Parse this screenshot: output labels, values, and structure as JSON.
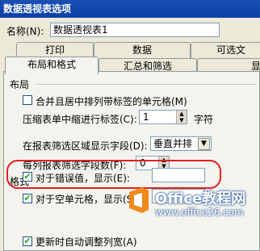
{
  "window": {
    "title": "数据透视表选项"
  },
  "name_field": {
    "label": "名称(N):",
    "value": "数据透视表1"
  },
  "tabs_back": [
    {
      "label": "打印"
    },
    {
      "label": "数据"
    },
    {
      "label": "可选文"
    }
  ],
  "tabs_front": [
    {
      "label": "布局和格式"
    },
    {
      "label": "汇总和筛选"
    },
    {
      "label": "显"
    }
  ],
  "layout_section": {
    "title": "布局",
    "merge_center_label": "合并且居中排列带标签的单元格(M)",
    "merge_center_checked": false,
    "indent_label": "压缩表单中缩进行标签(C):",
    "indent_value": "1",
    "indent_unit": "字符",
    "filter_area_label": "在报表筛选区域显示字段(D):",
    "filter_area_value": "垂直并排",
    "fields_per_col_label": "每列报表筛选字段数(F):",
    "fields_per_col_value": "0"
  },
  "format_section": {
    "title": "格式",
    "error_label": "对于错误值，显示(E):",
    "error_checked": true,
    "error_value": "",
    "empty_label": "对于空单元格，显示(S):",
    "empty_checked": true,
    "empty_value": "",
    "autofit_label": "更新时自动调整列宽(A)",
    "autofit_checked": true
  },
  "watermark": {
    "brand": "Office教程网",
    "url": "www.office26.com"
  },
  "colors": {
    "title_bar": "#0b3fa8",
    "highlight": "#e02020",
    "watermark_orange": "#f08a1c"
  }
}
